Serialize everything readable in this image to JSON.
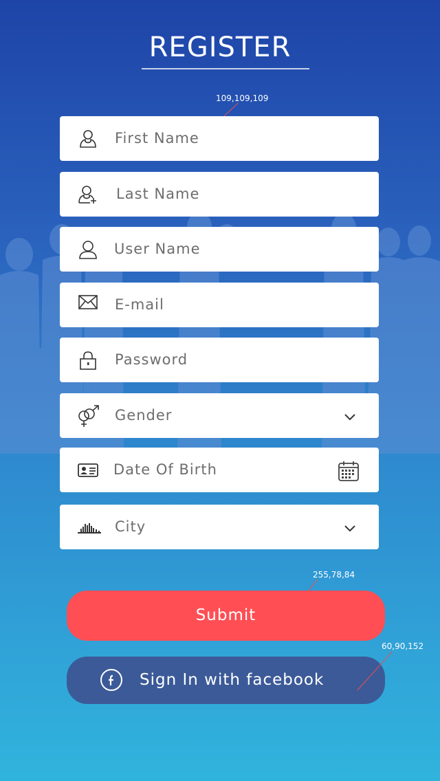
{
  "header": {
    "title": "REGISTER"
  },
  "annotations": {
    "field_text_color": "109,109,109",
    "submit_color": "255,78,84",
    "facebook_color": "60,90,152"
  },
  "fields": [
    {
      "label": "First Name",
      "icon": "user-icon"
    },
    {
      "label": "Last Name",
      "icon": "user-add-icon"
    },
    {
      "label": "User Name",
      "icon": "user-outline-icon"
    },
    {
      "label": "E-mail",
      "icon": "envelope-icon"
    },
    {
      "label": "Password",
      "icon": "lock-icon"
    },
    {
      "label": "Gender",
      "icon": "gender-icon",
      "trailing": "chevron-down-icon"
    },
    {
      "label": "Date Of Birth",
      "icon": "id-card-icon",
      "trailing": "calendar-icon"
    },
    {
      "label": "City",
      "icon": "city-skyline-icon",
      "trailing": "chevron-down-icon"
    }
  ],
  "buttons": {
    "submit_label": "Submit",
    "facebook_label": "Sign In with facebook"
  },
  "colors": {
    "field_text": "#6d6d6d",
    "submit": "#ff4e54",
    "facebook": "#3c5a98",
    "background_top": "#1e44a8",
    "background_bottom": "#30b4dd"
  }
}
